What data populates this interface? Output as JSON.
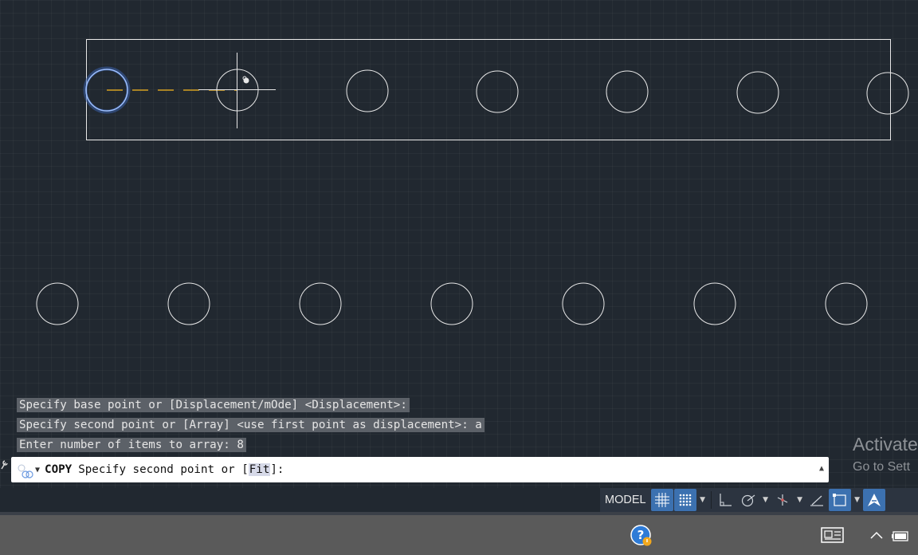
{
  "command_history": [
    "Specify base point or [Displacement/mOde] <Displacement>:",
    "Specify second point or [Array] <use first point as displacement>: a",
    "Enter number of items to array: 8"
  ],
  "command_line": {
    "command": "COPY",
    "prompt_before": "Specify second point or [",
    "option": "Fit",
    "prompt_after": "]:"
  },
  "watermark": {
    "line1": "Activate",
    "line2": "Go to Sett"
  },
  "status_bar": {
    "model_label": "MODEL",
    "icons": [
      "grid-icon",
      "snap-icon",
      "ortho-icon",
      "polar-icon",
      "isodraft-icon",
      "osnap-track-icon",
      "viewport-icon",
      "annotation-scale-icon"
    ]
  },
  "colors": {
    "canvas_bg": "#212830",
    "geometry": "#e8e8e8",
    "selection_highlight": "#5a86d6",
    "rubber_band": "#d6a020",
    "accent_blue": "#3c71b0"
  },
  "taskbar": {
    "icons": [
      "help-icon",
      "news-icon",
      "chevron-up-icon",
      "battery-icon"
    ]
  }
}
